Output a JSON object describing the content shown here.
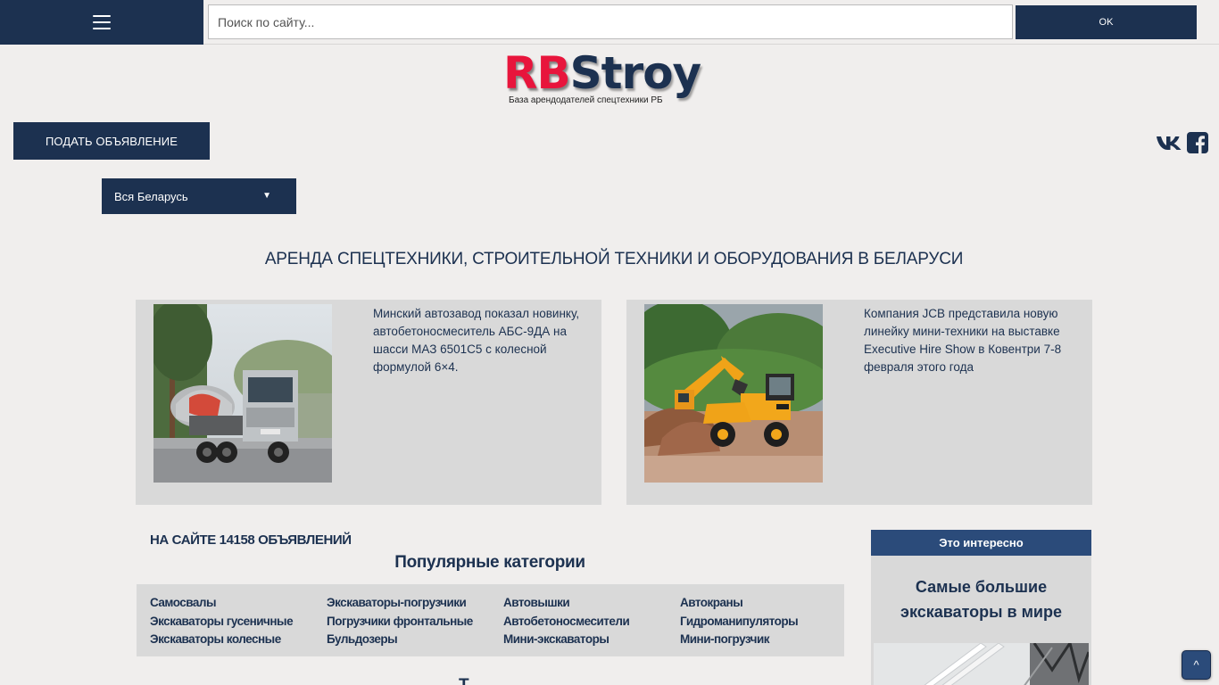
{
  "header": {
    "search_placeholder": "Поиск по сайту...",
    "search_button": "OK"
  },
  "logo": {
    "rb": "RB",
    "stroy": "Stroy",
    "tagline": "База арендодателей спецтехники РБ"
  },
  "actions": {
    "post_ad": "ПОДАТЬ ОБЪЯВЛЕНИЕ"
  },
  "region": {
    "selected": "Вся Беларусь",
    "caret": "▼"
  },
  "page_heading": "АРЕНДА СПЕЦТЕХНИКИ, СТРОИТЕЛЬНОЙ ТЕХНИКИ И ОБОРУДОВАНИЯ В БЕЛАРУСИ",
  "news": [
    {
      "text": "Минский автозавод показал новинку, автобетоносмеситель АБС-9ДА на шасси МАЗ 6501С5 с колесной формулой 6×4."
    },
    {
      "text": "Компания JCB представила новую линейку мини-техники на выставке Executive Hire Show в Ковентри 7-8 февраля этого года"
    }
  ],
  "listings": {
    "count_label": "НА САЙТЕ 14158 ОБЪЯВЛЕНИЙ",
    "popular_title": "Популярные категории",
    "categories": [
      "Самосвалы",
      "Экскаваторы-погрузчики",
      "Автовышки",
      "Автокраны",
      "Экскаваторы гусеничные",
      "Погрузчики фронтальные",
      "Автобетоносмесители",
      "Гидроманипуляторы",
      "Экскаваторы колесные",
      "Бульдозеры",
      "Мини-экскаваторы",
      "Мини-погрузчик"
    ],
    "next_title": "Т"
  },
  "sidebar": {
    "head": "Это интересно",
    "title": "Самые большие экскаваторы в мире"
  },
  "scroll_top": "^",
  "colors": {
    "brand_navy": "#1c3150",
    "accent_blue": "#2b4b7a",
    "logo_red": "#e8153c"
  }
}
